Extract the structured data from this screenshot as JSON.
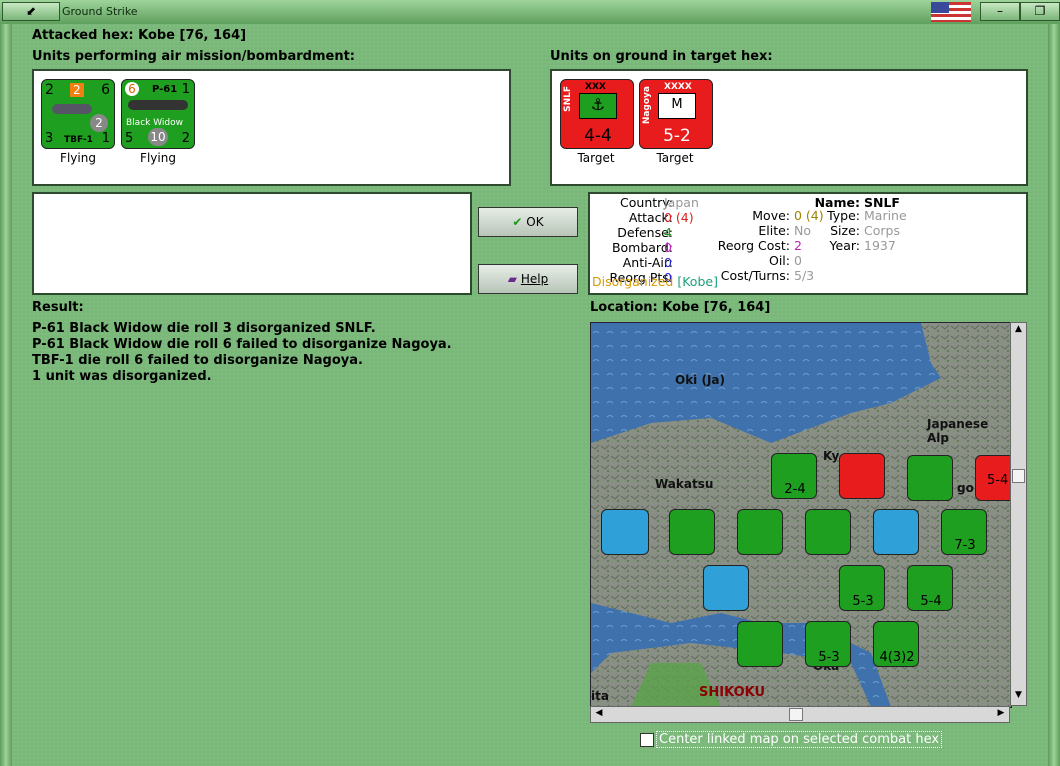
{
  "window": {
    "title": "Ground Strike"
  },
  "header": {
    "attacked_hex": "Attacked hex: Kobe  [76, 164]",
    "air_units_label": "Units performing air mission/bombardment:",
    "ground_units_label": "Units on ground in target hex:"
  },
  "air_units": [
    {
      "top_left": "2",
      "badge": "2",
      "top_right": "6",
      "mid": "2",
      "bl": "3",
      "name": "TBF-1",
      "br": "1",
      "caption": "Flying"
    },
    {
      "top_left": "6",
      "name_top": "P-61",
      "tr": "1",
      "name": "Black Widow",
      "bl": "5",
      "mid": "10",
      "br": "2",
      "caption": "Flying"
    }
  ],
  "ground_units": [
    {
      "side": "SNLF",
      "size": "XXX",
      "value": "4-4",
      "caption": "Target"
    },
    {
      "side": "Nagoya",
      "size": "XXXX",
      "value": "5-2",
      "caption": "Target",
      "letter": "M"
    }
  ],
  "buttons": {
    "ok": "OK",
    "help": "Help"
  },
  "unit_info": {
    "country_k": "Country:",
    "country_v": "Japan",
    "attack_k": "Attack:",
    "attack_v": "0 (4)",
    "defense_k": "Defense:",
    "defense_v": "4",
    "bombard_k": "Bombard:",
    "bombard_v": "0",
    "antiair_k": "Anti-Air:",
    "antiair_v": "0",
    "reorg_k": "Reorg Pts:",
    "reorg_v": "0",
    "status": "Disorganized",
    "status_loc": "[Kobe]",
    "move_k": "Move:",
    "move_v": "0 (4)",
    "elite_k": "Elite:",
    "elite_v": "No",
    "reorgcost_k": "Reorg Cost:",
    "reorgcost_v": "2",
    "oil_k": "Oil:",
    "oil_v": "0",
    "cost_k": "Cost/Turns:",
    "cost_v": "5/3",
    "name_k": "Name:",
    "name_v": "SNLF",
    "type_k": "Type:",
    "type_v": "Marine",
    "size_k": "Size:",
    "size_v": "Corps",
    "year_k": "Year:",
    "year_v": "1937"
  },
  "result": {
    "label": "Result:",
    "lines": [
      "P-61 Black Widow die roll 3 disorganized SNLF.",
      "P-61 Black Widow die roll 6 failed to disorganize Nagoya.",
      "TBF-1 die roll 6 failed to disorganize Nagoya.",
      "1 unit was disorganized."
    ]
  },
  "location": {
    "label": "Location:  Kobe  [76, 164]"
  },
  "map": {
    "labels": [
      "Oki (Ja)",
      "Japanese Alp",
      "Wakatsu",
      "SHIKOKU",
      "Ky",
      "Oka",
      "ita",
      "go"
    ],
    "counter_values": [
      "2-4",
      "7-3",
      "5-3",
      "5-4",
      "5-3",
      "4(3)2",
      "5-4"
    ]
  },
  "footer": {
    "center_linked": "Center linked map on selected combat hex"
  },
  "colors": {
    "unit_green": "#1f9f1f",
    "unit_red": "#e81c1c",
    "disorganized": "#d49a00",
    "kobe_link": "#1ea07a"
  }
}
